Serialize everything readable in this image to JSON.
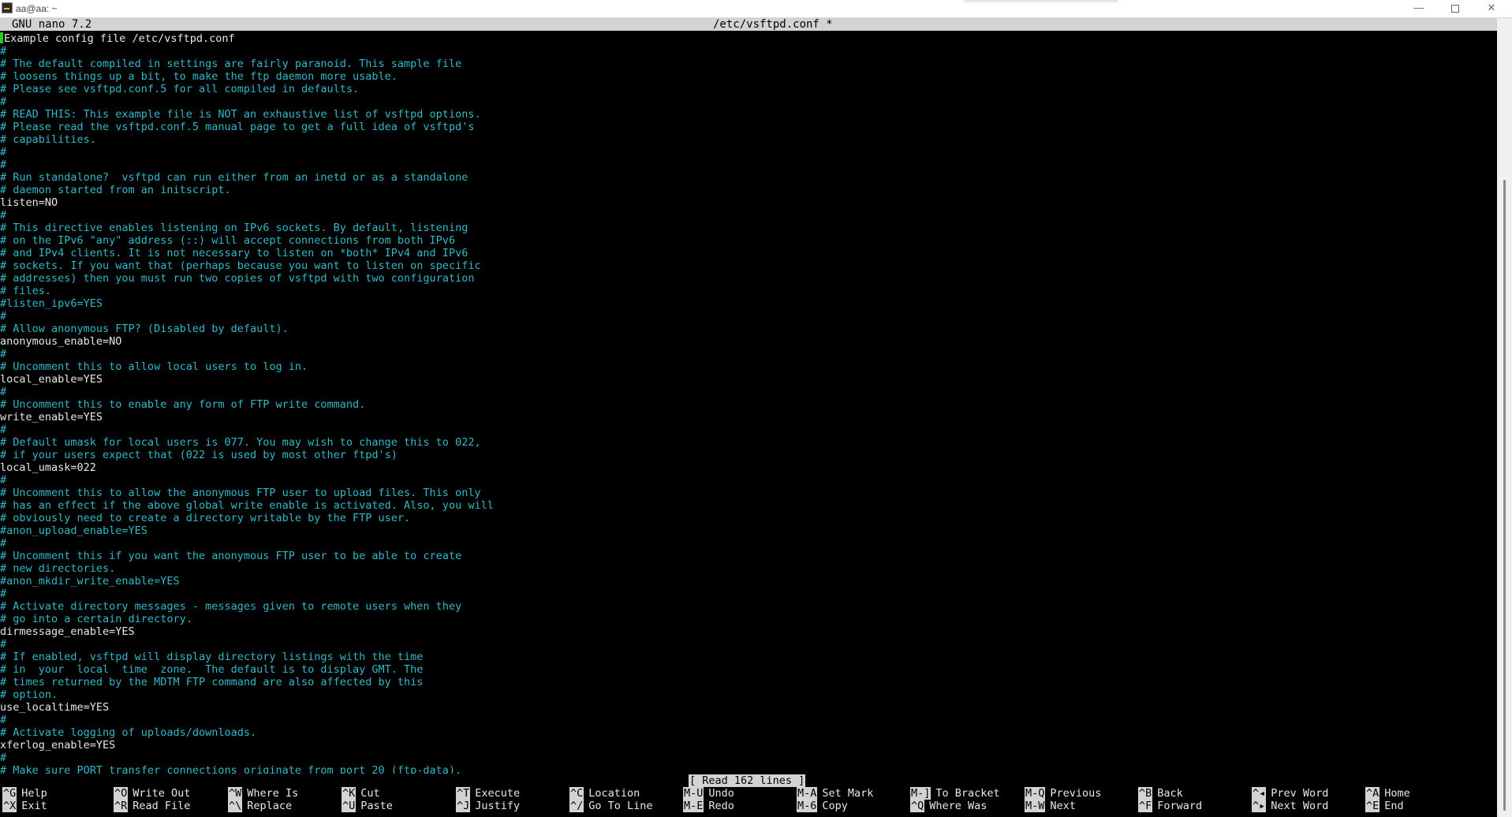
{
  "window": {
    "title": "aa@aa: ~",
    "minimize_glyph": "—",
    "close_glyph": "✕"
  },
  "nano": {
    "version": "GNU nano 7.2",
    "filename": "/etc/vsftpd.conf *",
    "status": "[ Read 162 lines ]"
  },
  "lines": [
    "Example config file /etc/vsftpd.conf",
    "#",
    "# The default compiled in settings are fairly paranoid. This sample file",
    "# loosens things up a bit, to make the ftp daemon more usable.",
    "# Please see vsftpd.conf.5 for all compiled in defaults.",
    "#",
    "# READ THIS: This example file is NOT an exhaustive list of vsftpd options.",
    "# Please read the vsftpd.conf.5 manual page to get a full idea of vsftpd's",
    "# capabilities.",
    "#",
    "#",
    "# Run standalone?  vsftpd can run either from an inetd or as a standalone",
    "# daemon started from an initscript.",
    "listen=NO",
    "#",
    "# This directive enables listening on IPv6 sockets. By default, listening",
    "# on the IPv6 \"any\" address (::) will accept connections from both IPv6",
    "# and IPv4 clients. It is not necessary to listen on *both* IPv4 and IPv6",
    "# sockets. If you want that (perhaps because you want to listen on specific",
    "# addresses) then you must run two copies of vsftpd with two configuration",
    "# files.",
    "#listen_ipv6=YES",
    "#",
    "# Allow anonymous FTP? (Disabled by default).",
    "anonymous_enable=NO",
    "#",
    "# Uncomment this to allow local users to log in.",
    "local_enable=YES",
    "#",
    "# Uncomment this to enable any form of FTP write command.",
    "write_enable=YES",
    "#",
    "# Default umask for local users is 077. You may wish to change this to 022,",
    "# if your users expect that (022 is used by most other ftpd's)",
    "local_umask=022",
    "#",
    "# Uncomment this to allow the anonymous FTP user to upload files. This only",
    "# has an effect if the above global write enable is activated. Also, you will",
    "# obviously need to create a directory writable by the FTP user.",
    "#anon_upload_enable=YES",
    "#",
    "# Uncomment this if you want the anonymous FTP user to be able to create",
    "# new directories.",
    "#anon_mkdir_write_enable=YES",
    "#",
    "# Activate directory messages - messages given to remote users when they",
    "# go into a certain directory.",
    "dirmessage_enable=YES",
    "#",
    "# If enabled, vsftpd will display directory listings with the time",
    "# in  your  local  time  zone.  The default is to display GMT. The",
    "# times returned by the MDTM FTP command are also affected by this",
    "# option.",
    "use_localtime=YES",
    "#",
    "# Activate logging of uploads/downloads.",
    "xferlog_enable=YES",
    "#",
    "# Make sure PORT transfer connections originate from port 20 (ftp-data)."
  ],
  "shortcuts": [
    {
      "key": "^G",
      "label": "Help"
    },
    {
      "key": "^X",
      "label": "Exit"
    },
    {
      "key": "^O",
      "label": "Write Out"
    },
    {
      "key": "^R",
      "label": "Read File"
    },
    {
      "key": "^W",
      "label": "Where Is"
    },
    {
      "key": "^\\",
      "label": "Replace"
    },
    {
      "key": "^K",
      "label": "Cut"
    },
    {
      "key": "^U",
      "label": "Paste"
    },
    {
      "key": "^T",
      "label": "Execute"
    },
    {
      "key": "^J",
      "label": "Justify"
    },
    {
      "key": "^C",
      "label": "Location"
    },
    {
      "key": "^/",
      "label": "Go To Line"
    },
    {
      "key": "M-U",
      "label": "Undo"
    },
    {
      "key": "M-E",
      "label": "Redo"
    },
    {
      "key": "M-A",
      "label": "Set Mark"
    },
    {
      "key": "M-6",
      "label": "Copy"
    },
    {
      "key": "M-]",
      "label": "To Bracket"
    },
    {
      "key": "^Q",
      "label": "Where Was"
    },
    {
      "key": "M-Q",
      "label": "Previous"
    },
    {
      "key": "M-W",
      "label": "Next"
    },
    {
      "key": "^B",
      "label": "Back"
    },
    {
      "key": "^F",
      "label": "Forward"
    },
    {
      "key": "^◂",
      "label": "Prev Word"
    },
    {
      "key": "^▸",
      "label": "Next Word"
    },
    {
      "key": "^A",
      "label": "Home"
    },
    {
      "key": "^E",
      "label": "End"
    }
  ],
  "colors": {
    "background": "#000000",
    "comment": "#33b8c8",
    "text": "#e8e8e8",
    "bar": "#d3d3d3",
    "cursor": "#22cc22"
  }
}
